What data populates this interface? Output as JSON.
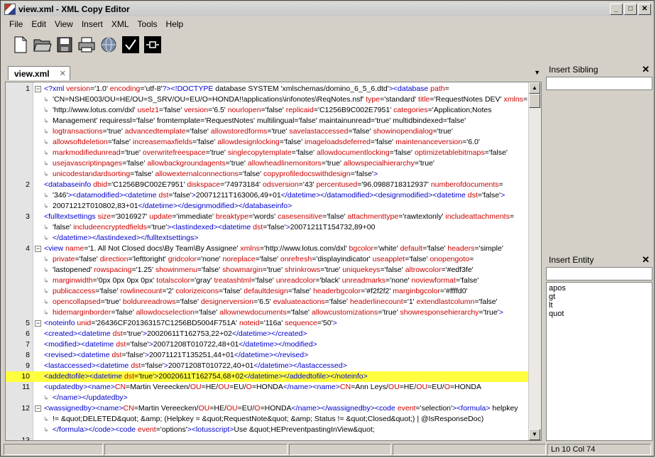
{
  "window": {
    "title": "view.xml - XML Copy Editor",
    "minimize": "_",
    "maximize": "□",
    "close": "✕"
  },
  "menu": [
    "File",
    "Edit",
    "View",
    "Insert",
    "XML",
    "Tools",
    "Help"
  ],
  "toolbar": [
    {
      "name": "new-document-button",
      "icon": "new-file-icon"
    },
    {
      "name": "open-button",
      "icon": "folder-open-icon"
    },
    {
      "name": "save-button",
      "icon": "floppy-disk-icon"
    },
    {
      "name": "print-button",
      "icon": "printer-icon"
    },
    {
      "name": "browser-button",
      "icon": "globe-icon"
    },
    {
      "name": "check-wellformed-button",
      "icon": "checkmark-icon"
    },
    {
      "name": "validate-button",
      "icon": "validate-icon"
    }
  ],
  "tab": {
    "label": "view.xml",
    "close": "✕",
    "menu": "▼"
  },
  "editor": {
    "fold_symbol": "⊟",
    "wrap_symbol": "↳",
    "lines": [
      {
        "num": "1",
        "fold": true,
        "text": "<?xml version='1.0' encoding='utf-8'?><!DOCTYPE database SYSTEM 'xmlschemas/domino_6_5_6.dtd'><database path="
      },
      {
        "num": "",
        "wrap": true,
        "text": "'CN=NSHE003/OU=HE/OU=S_SRV/OU=EU/O=HONDA!!applications\\infonotes\\ReqNotes.nsf' type='standard' title='RequestNotes DEV' xmlns="
      },
      {
        "num": "",
        "wrap": true,
        "text": "'http://www.lotus.com/dxl' uselz1='false' version='6.5' nourlopen='false' replicaid='C1256B9C002E7951' categories='Application;Notes"
      },
      {
        "num": "",
        "wrap": true,
        "text": "Management' requiressl='false' fromtemplate='RequestNotes' multilingual='false' maintainunread='true' multidbindexed='false'"
      },
      {
        "num": "",
        "wrap": true,
        "text": "logtransactions='true' advancedtemplate='false' allowstoredforms='true' savelastaccessed='false' showinopendialog='true'"
      },
      {
        "num": "",
        "wrap": true,
        "text": "allowsoftdeletion='false' increasemaxfields='false' allowdesignlocking='false' imageloadsdeferred='false' maintenanceversion='6.0'"
      },
      {
        "num": "",
        "wrap": true,
        "text": "markmodifiedunread='true' overwritefreespace='true' singlecopytemplate='false' allowdocumentlocking='false' optimizetablebitmaps='false'"
      },
      {
        "num": "",
        "wrap": true,
        "text": "usejavascriptinpages='false' allowbackgroundagents='true' allowheadlinemonitors='true' allowspecialhierarchy='true'"
      },
      {
        "num": "",
        "wrap": true,
        "text": "unicodestandardsorting='false' allowexternalconnections='false' copyprofiledocswithdesign='false'>"
      },
      {
        "num": "2",
        "fold": false,
        "text": "<databaseinfo dbid='C1256B9C002E7951' diskspace='74973184' odsversion='43' percentused='96.0988718312937' numberofdocuments="
      },
      {
        "num": "",
        "wrap": true,
        "text": "'346'><datamodified><datetime dst='false'>20071211T163006,49+01</datetime></datamodified><designmodified><datetime dst='false'>"
      },
      {
        "num": "",
        "wrap": true,
        "text": "20071212T010802,83+01</datetime></designmodified></databaseinfo>"
      },
      {
        "num": "3",
        "fold": false,
        "text": "<fulltextsettings size='3016927' update='immediate' breaktype='words' casesensitive='false' attachmenttype='rawtextonly' includeattachments="
      },
      {
        "num": "",
        "wrap": true,
        "text": "'false' includeencryptedfields='true'><lastindexed><datetime dst='false'>20071211T154732,89+00"
      },
      {
        "num": "",
        "wrap": true,
        "text": "</datetime></lastindexed></fulltextsettings>"
      },
      {
        "num": "4",
        "fold": true,
        "text": "<view name='1. All Not Closed docs\\By Team\\By Assignee' xmlns='http://www.lotus.com/dxl' bgcolor='white' default='false' headers='simple'"
      },
      {
        "num": "",
        "wrap": true,
        "text": "private='false' direction='lefttoright' gridcolor='none' noreplace='false' onrefresh='displayindicator' useapplet='false' onopengoto="
      },
      {
        "num": "",
        "wrap": true,
        "text": "'lastopened' rowspacing='1.25' showinmenu='false' showmargin='true' shrinkrows='true' uniquekeys='false' altrowcolor='#edf3fe'"
      },
      {
        "num": "",
        "wrap": true,
        "text": "marginwidth='0px 0px 0px 0px' totalscolor='gray' treatashtml='false' unreadcolor='black' unreadmarks='none' noviewformat='false'"
      },
      {
        "num": "",
        "wrap": true,
        "text": "publicaccess='false' rowlinecount='2' colorizeicons='false' defaultdesign='false' headerbgcolor='#f2f2f2' marginbgcolor='#ffffd0'"
      },
      {
        "num": "",
        "wrap": true,
        "text": "opencollapsed='true' boldunreadrows='false' designerversion='6.5' evaluateactions='false' headerlinecount='1' extendlastcolumn='false'"
      },
      {
        "num": "",
        "wrap": true,
        "text": "hidemarginborder='false' allowdocselection='false' allownewdocuments='false' allowcustomizations='true' showresponsehierarchy='true'>"
      },
      {
        "num": "5",
        "fold": true,
        "text": "<noteinfo unid='26436CF201363157C1256BD5004F751A' noteid='116a' sequence='50'>"
      },
      {
        "num": "6",
        "fold": false,
        "text": "<created><datetime dst='true'>20020611T162753,22+02</datetime></created>"
      },
      {
        "num": "7",
        "fold": false,
        "text": "<modified><datetime dst='false'>20071208T010722,48+01</datetime></modified>"
      },
      {
        "num": "8",
        "fold": false,
        "text": "<revised><datetime dst='false'>20071121T135251,44+01</datetime></revised>"
      },
      {
        "num": "9",
        "fold": false,
        "text": "<lastaccessed><datetime dst='false'>20071208T010722,40+01</datetime></lastaccessed>"
      },
      {
        "num": "10",
        "fold": false,
        "hl": true,
        "text": "<addedtofile><datetime dst='true'>20020611T162754,68+02</datetime></addedtofile></noteinfo>"
      },
      {
        "num": "11",
        "fold": false,
        "text": "<updatedby><name>CN=Martin Vereecken/OU=HE/OU=EU/O=HONDA</name><name>CN=Ann Leys/OU=HE/OU=EU/O=HONDA"
      },
      {
        "num": "",
        "wrap": true,
        "text": "</name></updatedby>"
      },
      {
        "num": "12",
        "fold": true,
        "text": "<wassignedby><name>CN=Martin Vereecken/OU=HE/OU=EU/O=HONDA</name></wassignedby><code event='selection'><formula> helpkey"
      },
      {
        "num": "",
        "wrap": true,
        "text": "!= &quot;DELETED&quot; &amp; (Helpkey = &quot;RequestNote&quot; &amp; Status != &quot;Closed&quot;) | @IsResponseDoc)"
      },
      {
        "num": "",
        "wrap": true,
        "text": "</formula></code><code event='options'><lotusscript>Use &quot;HEPreventpastingInView&quot;"
      },
      {
        "num": "13",
        "fold": false,
        "text": ""
      },
      {
        "num": "14",
        "fold": false,
        "text": "</lotusscript></code><code event='querypaste'><lotusscript>Sub Querypaste(Source As Notesuiview, Continue As Variant)"
      },
      {
        "num": "15",
        "fold": false,
        "text": "  continue = QueryPasteDocuments()"
      }
    ]
  },
  "panels": {
    "insert_sibling": {
      "title": "Insert Sibling",
      "close": "✕"
    },
    "insert_entity": {
      "title": "Insert Entity",
      "close": "✕",
      "items": [
        "apos",
        "gt",
        "lt",
        "quot"
      ]
    }
  },
  "status": {
    "position": "Ln 10 Col 74"
  },
  "colors": {
    "tag": "#0000cc",
    "attribute": "#cc0000",
    "value": "#000000",
    "highlight": "#ffff40"
  }
}
